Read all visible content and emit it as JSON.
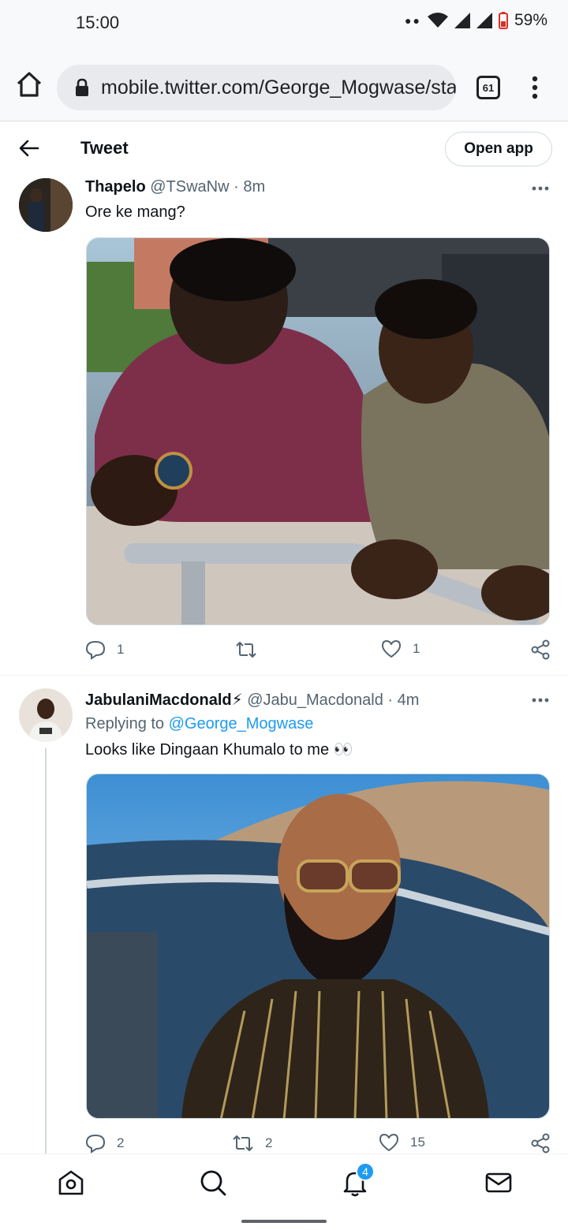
{
  "status_bar": {
    "time": "15:00",
    "battery": "59%"
  },
  "browser": {
    "url": "mobile.twitter.com/George_Mogwase/sta",
    "tab_count": "61"
  },
  "header": {
    "title": "Tweet",
    "open_app_label": "Open app"
  },
  "tweets": [
    {
      "name": "Thapelo",
      "handle": "@TSwaNw",
      "time": "· 8m",
      "text": "Ore ke mang?",
      "replies": "1",
      "retweets": "",
      "likes": "1"
    },
    {
      "name": "JabulaniMacdonald⚡",
      "handle": "@Jabu_Macdonald",
      "time": "· 4m",
      "replying_prefix": "Replying to",
      "replying_to": "@George_Mogwase",
      "text": "Looks like Dingaan Khumalo to me 👀",
      "replies": "2",
      "retweets": "2",
      "likes": "15"
    }
  ],
  "bottom_nav": {
    "notifications_badge": "4"
  },
  "colors": {
    "accent": "#1d9bf0",
    "text_primary": "#0f1419",
    "text_secondary": "#536471"
  },
  "icons": [
    "home-icon",
    "lock-icon",
    "more-vert-icon",
    "back-arrow-icon",
    "more-horizontal-icon",
    "reply-icon",
    "retweet-icon",
    "like-icon",
    "share-icon",
    "search-icon",
    "bell-icon",
    "mail-icon"
  ]
}
